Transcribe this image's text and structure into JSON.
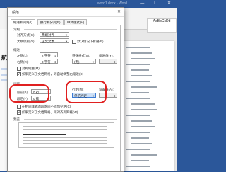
{
  "word": {
    "title": "word1.docx - Word",
    "style_label": "AaBbCcDd"
  },
  "left_nav": {
    "label": "航"
  },
  "dialog": {
    "title": "段落",
    "close_symbol": "✕",
    "tabs": [
      "缩进和间距(I)",
      "换行和分页(P)",
      "中文版式(H)"
    ],
    "general": {
      "title": "常规",
      "alignment_label": "对齐方式(G):",
      "alignment_value": "两端对齐",
      "outline_label": "大纲级别(O):",
      "outline_value": "正文文本",
      "collapse_label": "默认情况下折叠(E)"
    },
    "indent": {
      "title": "缩进",
      "left_label": "左侧(L):",
      "left_value": "2 字符",
      "right_label": "右侧(R):",
      "right_value": "0 字符",
      "special_label": "特殊格式(S):",
      "special_value": "(无)",
      "by_label": "缩进值(Y):",
      "mirror_label": "对称缩进(M)",
      "grid_label": "如果定义了文档网格，则自动调整右缩进(D)"
    },
    "spacing": {
      "title": "间距",
      "before_label": "段前(B):",
      "before_value": "0 行",
      "after_label": "段后(F):",
      "after_value": "0 磅",
      "line_label": "行距(N):",
      "line_value": "单倍行距",
      "at_label": "设置值(A):",
      "no_space_label": "在相同样式的段落间不添加空格(C)",
      "snap_label": "如果定义了文档网格，则对齐到网格(W)"
    },
    "preview": {
      "title": "预览"
    }
  }
}
